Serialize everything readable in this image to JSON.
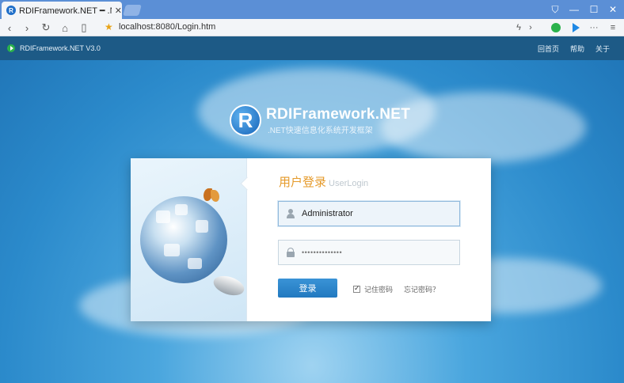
{
  "browser": {
    "tab_title": "RDIFramework.NET ━ .NET快",
    "tab_close": "✕",
    "url": "localhost:8080/Login.htm",
    "icons": [
      "back-icon",
      "forward-icon",
      "refresh-icon",
      "home-icon",
      "reader-icon",
      "star-icon",
      "flash-icon",
      "chevron-right-icon",
      "wechat-icon",
      "play-icon",
      "more-icon",
      "menu-icon"
    ]
  },
  "window_controls": {
    "shirt": "⛉",
    "min": "—",
    "max": "☐",
    "close": "✕"
  },
  "topbar": {
    "app_name": "RDIFramework.NET V3.0",
    "links": [
      "回首页",
      "帮助",
      "关于"
    ]
  },
  "brand": {
    "logo_letter": "R",
    "name": "RDIFramework.NET",
    "slogan": ".NET快速信息化系统开发框架"
  },
  "login": {
    "title": "用户登录",
    "subtitle": "UserLogin",
    "username_value": "Administrator",
    "password_value": "••••••••••••••",
    "button_label": "登录",
    "remember_label": "记住密码",
    "remember_checked": true,
    "forgot_label": "忘记密码？"
  },
  "colors": {
    "accent": "#2279c0",
    "title_orange": "#e59a2a",
    "topbar": "#1d5a86"
  }
}
